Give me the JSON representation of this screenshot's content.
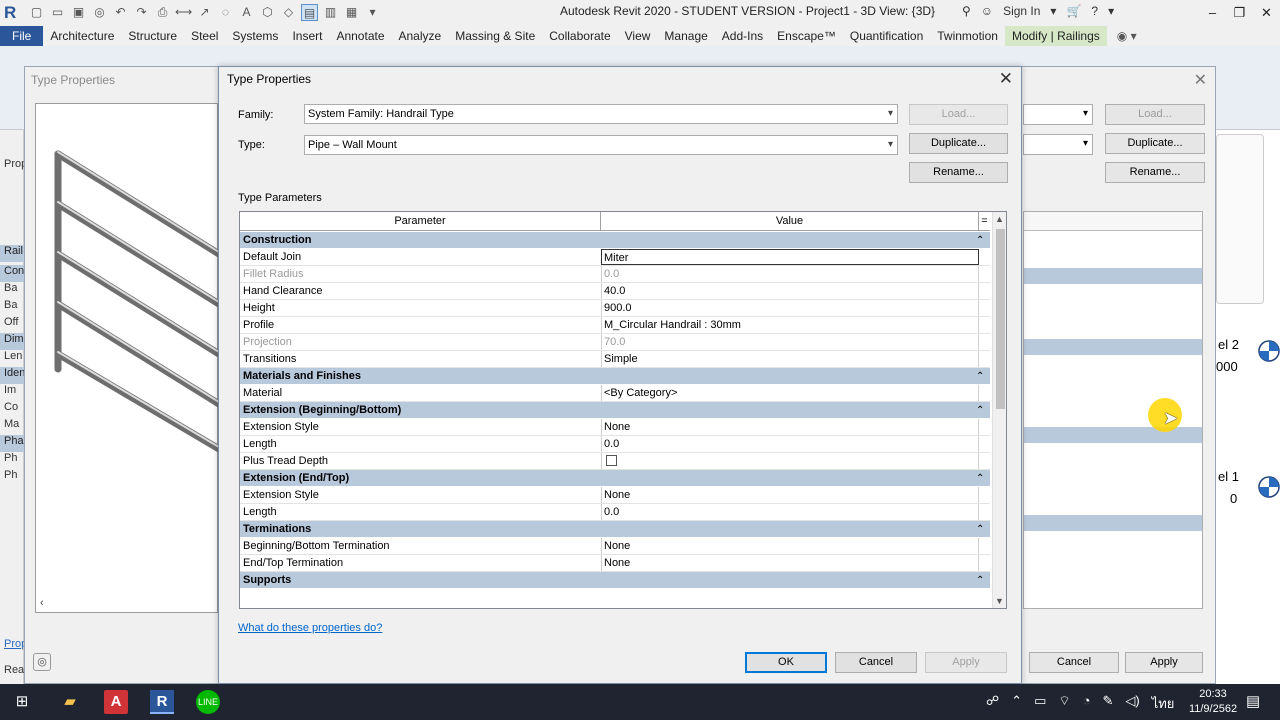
{
  "app": {
    "title": "Autodesk Revit 2020 - STUDENT VERSION - Project1 - 3D View: {3D}",
    "sign_in": "Sign In"
  },
  "ribbon": {
    "tabs": [
      "File",
      "Architecture",
      "Structure",
      "Steel",
      "Systems",
      "Insert",
      "Annotate",
      "Analyze",
      "Massing & Site",
      "Collaborate",
      "View",
      "Manage",
      "Add-Ins",
      "Enscape™",
      "Quantification",
      "Twinmotion",
      "Modify | Railings"
    ],
    "active_tab": "Modify | Railings"
  },
  "background": {
    "dialog_title": "Type Properties",
    "left_panel_rows": [
      "Prop",
      "Rail",
      "Con",
      "Ba",
      "Ba",
      "Off",
      "Dim",
      "Len",
      "Iden",
      "Im",
      "Co",
      "Ma",
      "Pha",
      "Ph",
      "Ph"
    ],
    "properties_link": "Prop",
    "status": "Read",
    "right_view": {
      "level2": "el 2",
      "level2_value": "000",
      "level1": "el 1",
      "level1_value": "0"
    },
    "buttons": {
      "load": "Load...",
      "duplicate": "Duplicate...",
      "rename": "Rename...",
      "cancel": "Cancel",
      "apply": "Apply"
    }
  },
  "dialog": {
    "title": "Type Properties",
    "family_label": "Family:",
    "family_value": "System Family: Handrail Type",
    "type_label": "Type:",
    "type_value": "Pipe – Wall Mount",
    "load_button": "Load...",
    "duplicate_button": "Duplicate...",
    "rename_button": "Rename...",
    "type_parameters_label": "Type Parameters",
    "columns": {
      "parameter": "Parameter",
      "value": "Value",
      "extra": "="
    },
    "groups": [
      {
        "name": "Construction",
        "rows": [
          {
            "name": "Default Join",
            "value": "Miter",
            "state": "selected"
          },
          {
            "name": "Fillet Radius",
            "value": "0.0",
            "state": "disabled"
          },
          {
            "name": "Hand Clearance",
            "value": "40.0",
            "state": "normal"
          },
          {
            "name": "Height",
            "value": "900.0",
            "state": "normal"
          },
          {
            "name": "Profile",
            "value": "M_Circular Handrail : 30mm",
            "state": "normal"
          },
          {
            "name": "Projection",
            "value": "70.0",
            "state": "disabled"
          },
          {
            "name": "Transitions",
            "value": "Simple",
            "state": "normal"
          }
        ]
      },
      {
        "name": "Materials and Finishes",
        "rows": [
          {
            "name": "Material",
            "value": "<By Category>",
            "state": "normal"
          }
        ]
      },
      {
        "name": "Extension (Beginning/Bottom)",
        "rows": [
          {
            "name": "Extension Style",
            "value": "None",
            "state": "normal"
          },
          {
            "name": "Length",
            "value": "0.0",
            "state": "normal"
          },
          {
            "name": "Plus Tread Depth",
            "value": "",
            "state": "checkbox"
          }
        ]
      },
      {
        "name": "Extension (End/Top)",
        "rows": [
          {
            "name": "Extension Style",
            "value": "None",
            "state": "normal"
          },
          {
            "name": "Length",
            "value": "0.0",
            "state": "normal"
          }
        ]
      },
      {
        "name": "Terminations",
        "rows": [
          {
            "name": "Beginning/Bottom Termination",
            "value": "None",
            "state": "normal"
          },
          {
            "name": "End/Top Termination",
            "value": "None",
            "state": "normal"
          }
        ]
      },
      {
        "name": "Supports",
        "rows": []
      }
    ],
    "help_link": "What do these properties do?",
    "ok_button": "OK",
    "cancel_button": "Cancel",
    "apply_button": "Apply"
  },
  "taskbar": {
    "time": "20:33",
    "date": "11/9/2562",
    "lang": "ไทย"
  }
}
